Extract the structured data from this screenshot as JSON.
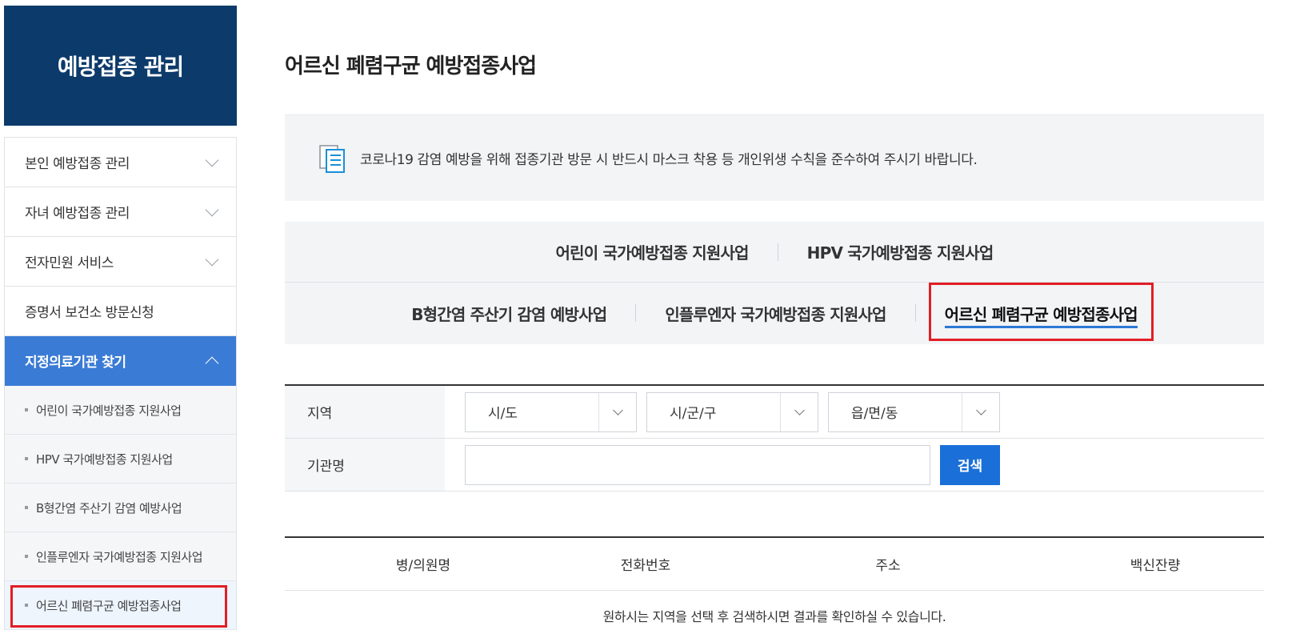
{
  "sidebar": {
    "title": "예방접종 관리",
    "items": [
      {
        "label": "본인 예방접종 관리"
      },
      {
        "label": "자녀 예방접종 관리"
      },
      {
        "label": "전자민원 서비스"
      },
      {
        "label": "증명서 보건소 방문신청"
      },
      {
        "label": "지정의료기관 찾기"
      }
    ],
    "sub_items": [
      {
        "label": "어린이 국가예방접종 지원사업"
      },
      {
        "label": "HPV 국가예방접종 지원사업"
      },
      {
        "label": "B형간염 주산기 감염 예방사업"
      },
      {
        "label": "인플루엔자 국가예방접종 지원사업"
      },
      {
        "label": "어르신 폐렴구균 예방접종사업"
      }
    ]
  },
  "main": {
    "title": "어르신 폐렴구균 예방접종사업",
    "notice": "코로나19 감염 예방을 위해 접종기관 방문 시 반드시 마스크 착용 등 개인위생 수칙을 준수하여 주시기 바랍니다.",
    "tabs_row1": [
      {
        "label": "어린이 국가예방접종 지원사업"
      },
      {
        "label": "HPV 국가예방접종 지원사업"
      }
    ],
    "tabs_row2": [
      {
        "label": "B형간염 주산기 감염 예방사업"
      },
      {
        "label": "인플루엔자 국가예방접종 지원사업"
      },
      {
        "label": "어르신 폐렴구균 예방접종사업"
      }
    ]
  },
  "search": {
    "region_label": "지역",
    "sido": "시/도",
    "sigungu": "시/군/구",
    "eupmyeondong": "읍/면/동",
    "name_label": "기관명",
    "name_value": "",
    "button": "검색"
  },
  "results": {
    "columns": [
      "병/의원명",
      "전화번호",
      "주소",
      "백신잔량"
    ],
    "empty_message": "원하시는 지역을 선택 후 검색하시면 결과를 확인하실 수 있습니다."
  }
}
